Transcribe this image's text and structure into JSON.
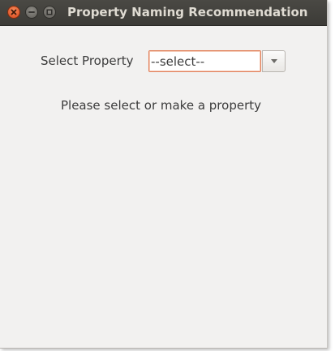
{
  "window": {
    "title": "Property Naming Recommendation",
    "controls": {
      "close_icon": "close-icon",
      "minimize_icon": "minimize-icon",
      "maximize_icon": "maximize-icon"
    }
  },
  "form": {
    "property_label": "Select Property",
    "property_select": {
      "value": "--select--",
      "dropdown_icon": "chevron-down-icon"
    }
  },
  "message": "Please select or make a property",
  "colors": {
    "titlebar": "#3c3b37",
    "title_text": "#dfdbd2",
    "close_button": "#e05b2c",
    "focus_border": "#e2805a",
    "window_background": "#f2f1f0"
  }
}
